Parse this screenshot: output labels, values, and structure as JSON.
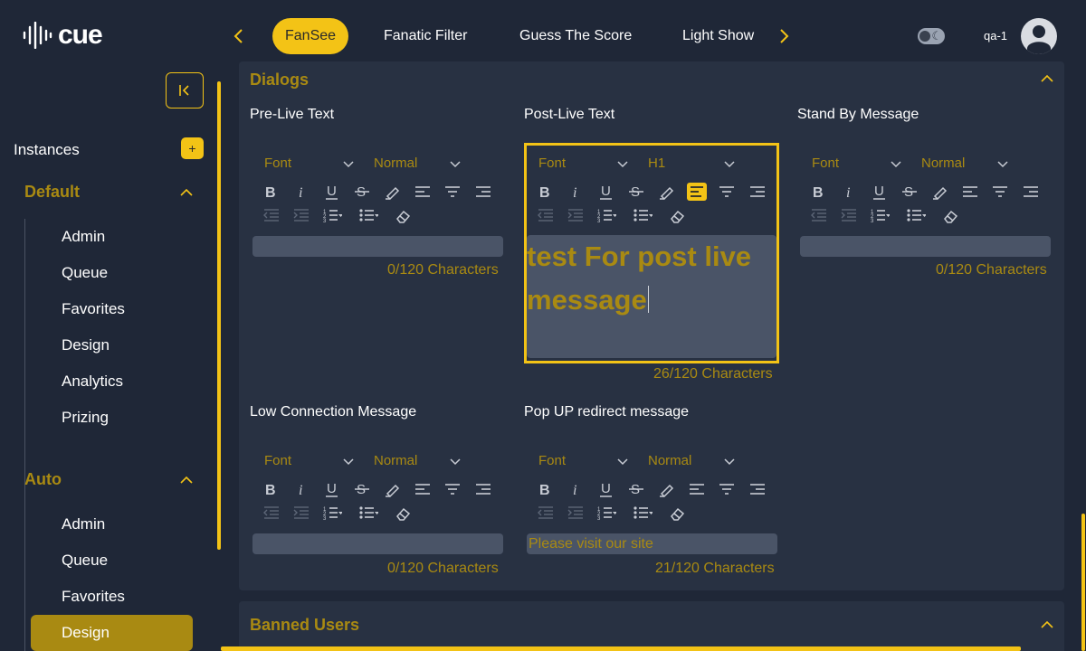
{
  "brand": {
    "name": "cue"
  },
  "header": {
    "tabs": [
      {
        "label": "FanSee",
        "active": true
      },
      {
        "label": "Fanatic Filter"
      },
      {
        "label": "Guess The Score"
      },
      {
        "label": "Light Show"
      }
    ],
    "user": "qa-1"
  },
  "sidebar": {
    "instances_label": "Instances",
    "add_label": "+",
    "groups": [
      {
        "title": "Default",
        "items": [
          "Admin",
          "Queue",
          "Favorites",
          "Design",
          "Analytics",
          "Prizing"
        ]
      },
      {
        "title": "Auto",
        "items": [
          "Admin",
          "Queue",
          "Favorites",
          "Design"
        ]
      }
    ],
    "active_item": "Auto / Design"
  },
  "dialogs": {
    "title": "Dialogs",
    "fields": [
      {
        "label": "Pre-Live Text",
        "font": "Font",
        "size": "Normal",
        "text": "",
        "count": "0/120 Characters"
      },
      {
        "label": "Post-Live Text",
        "font": "Font",
        "size": "H1",
        "text": "test For post live message",
        "count": "26/120 Characters"
      },
      {
        "label": "Stand By Message",
        "font": "Font",
        "size": "Normal",
        "text": "",
        "count": "0/120 Characters"
      },
      {
        "label": "Low Connection Message",
        "font": "Font",
        "size": "Normal",
        "text": "",
        "count": "0/120 Characters"
      },
      {
        "label": "Pop UP redirect message",
        "font": "Font",
        "size": "Normal",
        "text": "Please visit our site",
        "count": "21/120 Characters"
      }
    ]
  },
  "banned": {
    "title": "Banned Users"
  },
  "colors": {
    "accent": "#f3c316",
    "accent_dark": "#a98a12",
    "bg": "#1f2737",
    "panel": "#283142"
  }
}
